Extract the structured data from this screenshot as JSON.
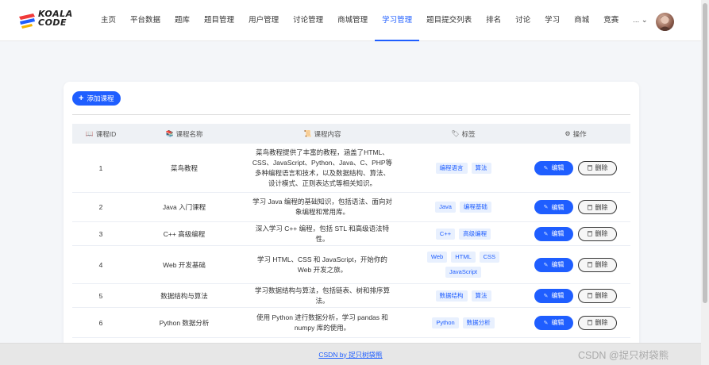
{
  "brand": {
    "line1": "KOALA",
    "line2": "CODE"
  },
  "nav": {
    "items": [
      "主页",
      "平台数据",
      "题库",
      "题目管理",
      "用户管理",
      "讨论管理",
      "商城管理",
      "学习管理",
      "题目提交列表",
      "排名",
      "讨论",
      "学习",
      "商城",
      "竞赛"
    ],
    "active": "学习管理",
    "more_label": "... ⌄"
  },
  "toolbar": {
    "add_label": "添加课程"
  },
  "table": {
    "headers": [
      "课程ID",
      "课程名称",
      "课程内容",
      "标签",
      "操作"
    ],
    "header_icons": [
      "📖",
      "📚",
      "📜",
      "🏷",
      "⚙"
    ],
    "edit_label": "编辑",
    "delete_label": "删除",
    "rows": [
      {
        "id": "1",
        "name": "菜鸟教程",
        "desc": "菜鸟教程提供了丰富的教程，涵盖了HTML、CSS、JavaScript、Python、Java、C、PHP等多种编程语言和技术，以及数据结构、算法、设计模式、正则表达式等相关知识。",
        "tags": [
          "编程语言",
          "算法"
        ]
      },
      {
        "id": "2",
        "name": "Java 入门课程",
        "desc": "学习 Java 编程的基础知识，包括语法、面向对象编程和常用库。",
        "tags": [
          "Java",
          "编程基础"
        ]
      },
      {
        "id": "3",
        "name": "C++ 高级编程",
        "desc": "深入学习 C++ 编程，包括 STL 和高级语法特性。",
        "tags": [
          "C++",
          "高级编程"
        ]
      },
      {
        "id": "4",
        "name": "Web 开发基础",
        "desc": "学习 HTML、CSS 和 JavaScript，开始你的 Web 开发之旅。",
        "tags": [
          "Web",
          "HTML",
          "CSS",
          "JavaScript"
        ]
      },
      {
        "id": "5",
        "name": "数据结构与算法",
        "desc": "学习数据结构与算法，包括链表、树和排序算法。",
        "tags": [
          "数据结构",
          "算法"
        ]
      },
      {
        "id": "6",
        "name": "Python 数据分析",
        "desc": "使用 Python 进行数据分析，学习 pandas 和 numpy 库的使用。",
        "tags": [
          "Python",
          "数据分析"
        ]
      }
    ]
  },
  "footer": {
    "link": "CSDN by 捉只树袋熊"
  },
  "watermark": "CSDN @捉只树袋熊",
  "colors": {
    "primary": "#1f5eff",
    "tag_bg": "#e8f0fe",
    "footer_bg": "#e7e7e7"
  }
}
